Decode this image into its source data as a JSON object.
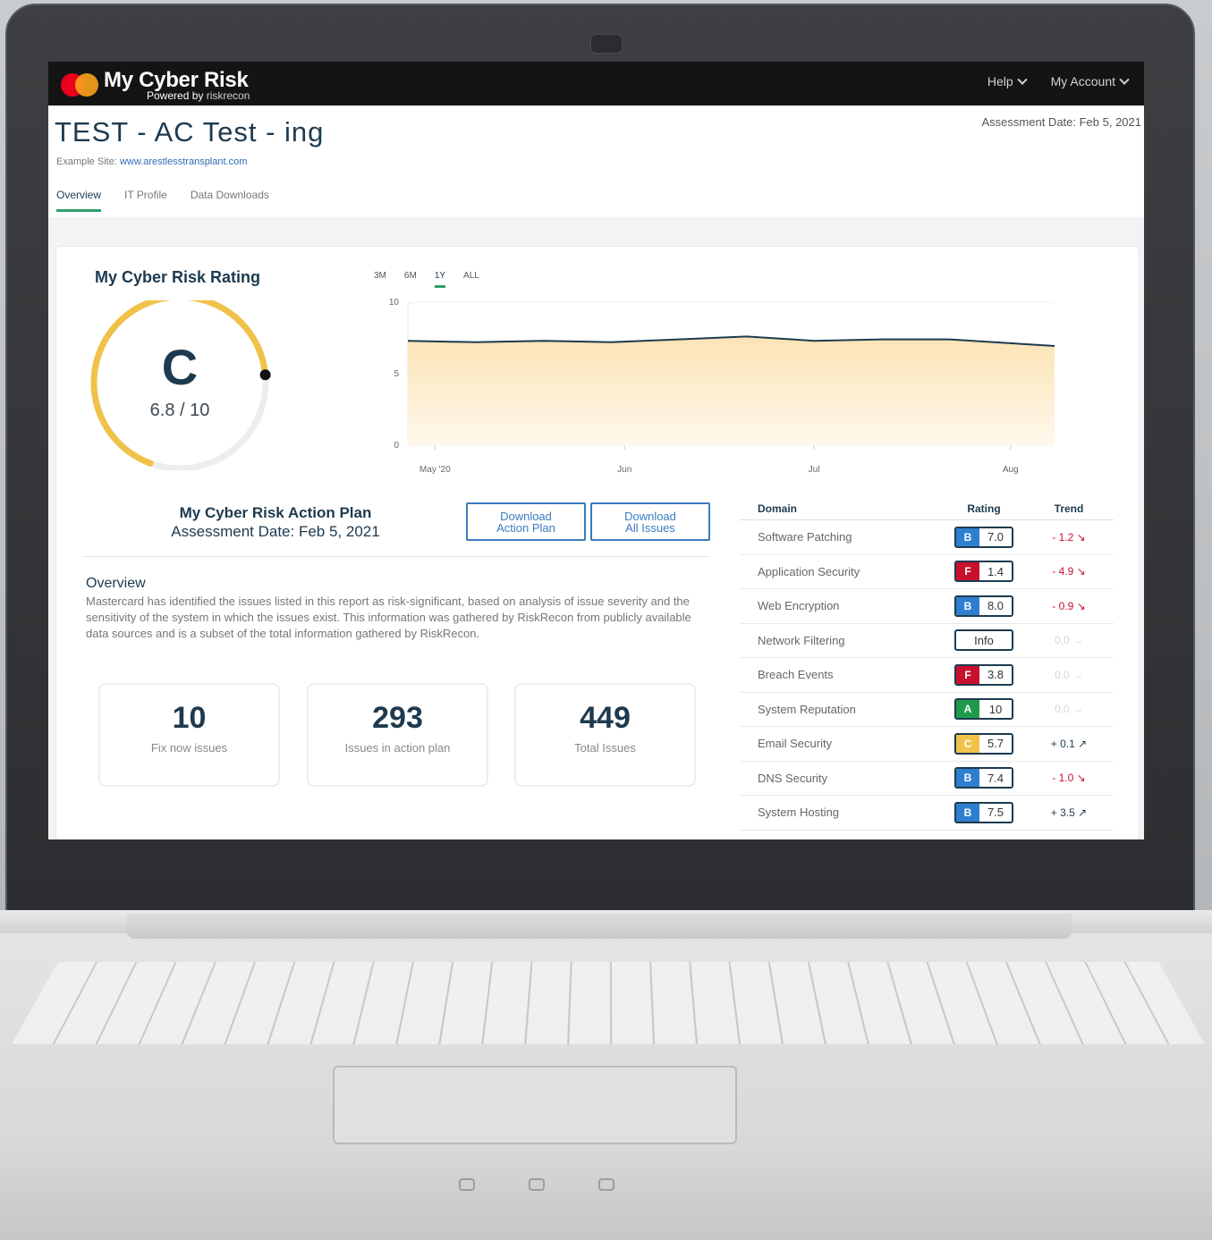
{
  "app": {
    "name": "My Cyber Risk",
    "powered_by": "Powered by",
    "powered_brand": "riskrecon"
  },
  "nav": {
    "help": "Help",
    "account": "My Account"
  },
  "header": {
    "title": "TEST - AC Test - ing",
    "assessment_date": "Assessment Date: Feb 5, 2021",
    "example_label": "Example Site:",
    "example_url": "www.arestlesstransplant.com",
    "tabs": [
      "Overview",
      "IT Profile",
      "Data Downloads"
    ]
  },
  "rating": {
    "title": "My Cyber Risk Rating",
    "grade": "C",
    "score_text": "6.8 / 10",
    "score": 6.8,
    "max": 10,
    "color": "#f0c24a"
  },
  "chart_data": {
    "type": "area",
    "ranges": [
      "3M",
      "6M",
      "1Y",
      "ALL"
    ],
    "active_range": "1Y",
    "x_ticks": [
      "May '20",
      "Jun",
      "Jul",
      "Aug"
    ],
    "y_ticks": [
      "10",
      "5",
      "0"
    ],
    "ylim": [
      0,
      10
    ],
    "series": [
      {
        "values": [
          7.3,
          7.2,
          7.3,
          7.2,
          7.4,
          7.6,
          7.3,
          7.4,
          7.4,
          7.1,
          6.8
        ]
      }
    ],
    "line_color": "#1d3a4f",
    "fill_color": "#fbe3b4"
  },
  "action_plan": {
    "title": "My Cyber Risk Action Plan",
    "subtitle": "Assessment Date: Feb 5, 2021",
    "btn_plan": [
      "Download",
      "Action Plan"
    ],
    "btn_issues": [
      "Download",
      "All Issues"
    ]
  },
  "overview": {
    "title": "Overview",
    "text": "Mastercard has identified the issues listed in this report as risk-significant, based on analysis of issue severity and the sensitivity of the system in which the issues exist. This information was gathered by RiskRecon from publicly available data sources and is a subset of the total information gathered by RiskRecon."
  },
  "stats": [
    {
      "value": "10",
      "label": "Fix now issues"
    },
    {
      "value": "293",
      "label": "Issues in action plan"
    },
    {
      "value": "449",
      "label": "Total Issues"
    }
  ],
  "domains": {
    "headers": {
      "domain": "Domain",
      "rating": "Rating",
      "trend": "Trend"
    },
    "rows": [
      {
        "name": "Software Patching",
        "grade": "B",
        "value": "7.0",
        "color": "#2f7fd1",
        "trend": "- 1.2",
        "dir": "down"
      },
      {
        "name": "Application Security",
        "grade": "F",
        "value": "1.4",
        "color": "#c8102e",
        "trend": "- 4.9",
        "dir": "down"
      },
      {
        "name": "Web Encryption",
        "grade": "B",
        "value": "8.0",
        "color": "#2f7fd1",
        "trend": "- 0.9",
        "dir": "down"
      },
      {
        "name": "Network Filtering",
        "grade": "",
        "value": "Info",
        "color": "",
        "trend": "0.0",
        "dir": "none"
      },
      {
        "name": "Breach Events",
        "grade": "F",
        "value": "3.8",
        "color": "#c8102e",
        "trend": "0.0",
        "dir": "none"
      },
      {
        "name": "System Reputation",
        "grade": "A",
        "value": "10",
        "color": "#1f9a4a",
        "trend": "0.0",
        "dir": "none"
      },
      {
        "name": "Email Security",
        "grade": "C",
        "value": "5.7",
        "color": "#f0c24a",
        "trend": "+ 0.1",
        "dir": "up"
      },
      {
        "name": "DNS Security",
        "grade": "B",
        "value": "7.4",
        "color": "#2f7fd1",
        "trend": "- 1.0",
        "dir": "down"
      },
      {
        "name": "System Hosting",
        "grade": "B",
        "value": "7.5",
        "color": "#2f7fd1",
        "trend": "+ 3.5",
        "dir": "up"
      }
    ]
  }
}
